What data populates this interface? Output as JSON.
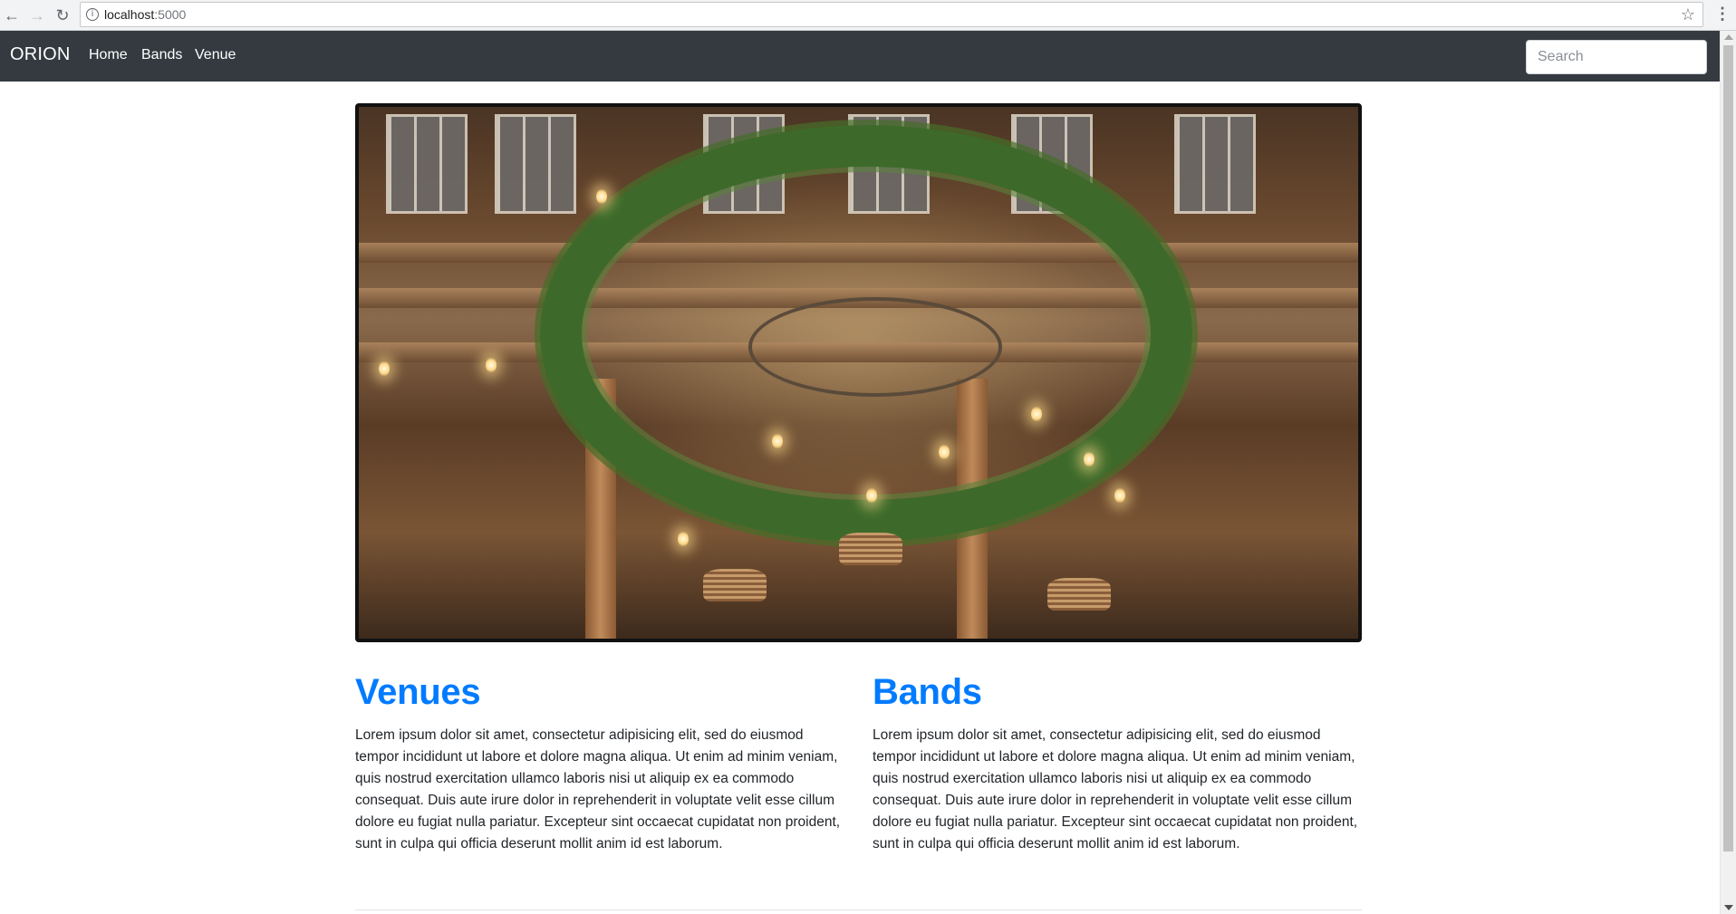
{
  "browser": {
    "url_host": "localhost",
    "url_port": ":5000",
    "icons": {
      "back": "arrow-left-icon",
      "forward": "arrow-right-icon",
      "reload": "reload-icon",
      "info": "info-icon",
      "bookmark": "star-icon",
      "menu": "kebab-menu-icon"
    }
  },
  "navbar": {
    "brand": "ORION",
    "links": [
      {
        "label": "Home"
      },
      {
        "label": "Bands"
      },
      {
        "label": "Venue"
      }
    ],
    "search_placeholder": "Search"
  },
  "hero": {
    "image": "venue-interior-photo"
  },
  "sections": [
    {
      "title": "Venues",
      "body": "Lorem ipsum dolor sit amet, consectetur adipisicing elit, sed do eiusmod tempor incididunt ut labore et dolore magna aliqua. Ut enim ad minim veniam, quis nostrud exercitation ullamco laboris nisi ut aliquip ex ea commodo consequat. Duis aute irure dolor in reprehenderit in voluptate velit esse cillum dolore eu fugiat nulla pariatur. Excepteur sint occaecat cupidatat non proident, sunt in culpa qui officia deserunt mollit anim id est laborum."
    },
    {
      "title": "Bands",
      "body": "Lorem ipsum dolor sit amet, consectetur adipisicing elit, sed do eiusmod tempor incididunt ut labore et dolore magna aliqua. Ut enim ad minim veniam, quis nostrud exercitation ullamco laboris nisi ut aliquip ex ea commodo consequat. Duis aute irure dolor in reprehenderit in voluptate velit esse cillum dolore eu fugiat nulla pariatur. Excepteur sint occaecat cupidatat non proident, sunt in culpa qui officia deserunt mollit anim id est laborum."
    }
  ],
  "colors": {
    "navbar_bg": "#343a40",
    "heading": "#007bff",
    "text": "#212529"
  }
}
